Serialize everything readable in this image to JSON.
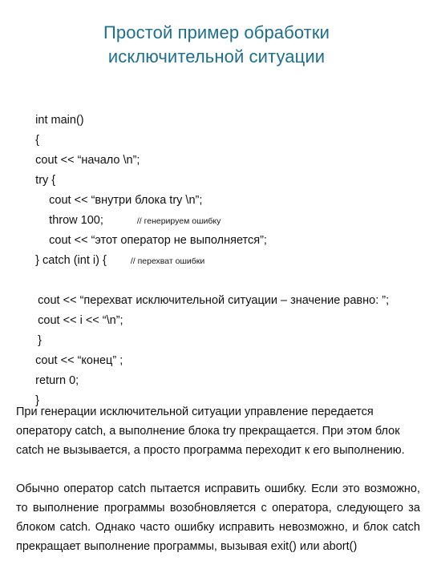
{
  "slide": {
    "background_color": "#ffffff",
    "title": {
      "color": "#1f6e8c",
      "line1": "Простой пример обработки",
      "line2": "исключительной ситуации"
    },
    "code": {
      "lines": [
        {
          "text": "int main()",
          "indent": "none",
          "comment": ""
        },
        {
          "text": "{",
          "indent": "none",
          "comment": ""
        },
        {
          "text": "cout << “начало \\n”;",
          "indent": "none",
          "comment": ""
        },
        {
          "text": "try {",
          "indent": "none",
          "comment": ""
        },
        {
          "text": "cout << “внутри блока try \\n”;",
          "indent": "deep",
          "comment": ""
        },
        {
          "text": "throw 100;",
          "indent": "deep",
          "comment": "// генерируем ошибку"
        },
        {
          "text": "cout << “этот оператор не выполняется”;",
          "indent": "deep",
          "comment": ""
        },
        {
          "text": "} catch (int i) {",
          "indent": "none",
          "comment": "// перехват ошибки"
        },
        {
          "text": "",
          "indent": "none",
          "comment": ""
        },
        {
          "text": "cout << “перехват исключительной ситуации – значение равно: ”;",
          "indent": "small",
          "comment": ""
        },
        {
          "text": "cout << i << “\\n”;",
          "indent": "small",
          "comment": ""
        },
        {
          "text": "}",
          "indent": "small",
          "comment": ""
        },
        {
          "text": "cout << “конец” ;",
          "indent": "none",
          "comment": ""
        },
        {
          "text": "return 0;",
          "indent": "none",
          "comment": ""
        },
        {
          "text": "}",
          "indent": "none",
          "comment": ""
        }
      ]
    },
    "paragraphs": {
      "p1": "При генерации исключительной ситуации управление передается оператору catch, а выполнение блока try прекращается. При этом блок catch не вызывается, а просто программа переходит к его выполнению.",
      "p2": "Обычно оператор catch пытается исправить ошибку. Если это возможно, то выполнение программы возобновляется с оператора, следующего за блоком catch. Однако часто ошибку исправить невозможно, и блок catch прекращает выполнение программы, вызывая exit() или abort()"
    }
  }
}
